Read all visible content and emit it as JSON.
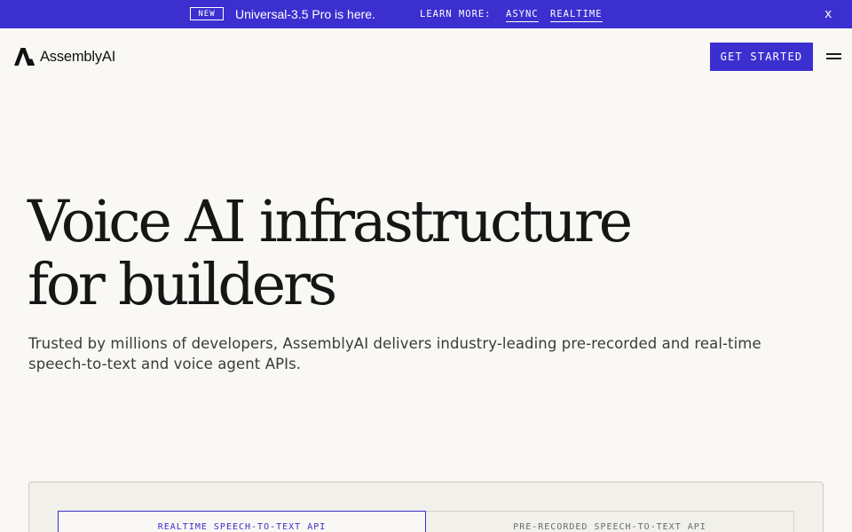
{
  "announcement": {
    "badge": "NEW",
    "text": "Universal-3.5 Pro is here.",
    "learn_more": "LEARN MORE:",
    "links": [
      "ASYNC",
      "REALTIME"
    ],
    "close": "x"
  },
  "header": {
    "brand": "AssemblyAI",
    "cta": "GET STARTED",
    "menu_icon": "hamburger-icon"
  },
  "hero": {
    "title_line1": "Voice AI infrastructure",
    "title_line2": "for builders",
    "subtitle": "Trusted by millions of developers, AssemblyAI delivers industry-leading pre-recorded and real-time speech-to-text and voice agent APIs."
  },
  "tabs": [
    {
      "label": "REALTIME SPEECH-TO-TEXT API",
      "active": true
    },
    {
      "label": "PRE-RECORDED SPEECH-TO-TEXT API",
      "active": false
    }
  ],
  "colors": {
    "accent": "#3c2fcf",
    "background": "#f9f8f4",
    "text": "#1a1a1a"
  }
}
